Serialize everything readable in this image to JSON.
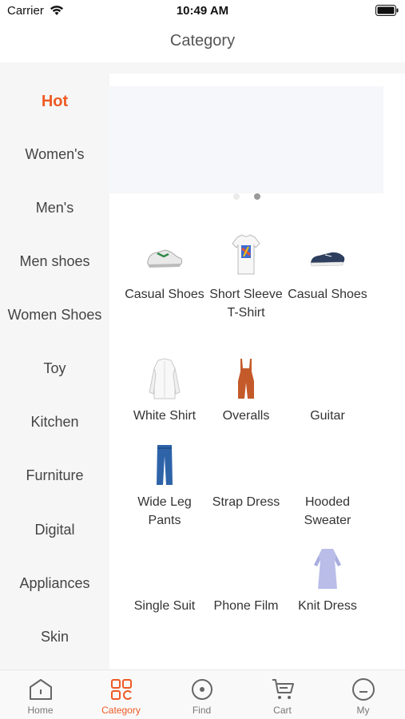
{
  "status_bar": {
    "carrier": "Carrier",
    "time": "10:49 AM"
  },
  "nav": {
    "title": "Category"
  },
  "sidebar": {
    "items": [
      {
        "label": "Hot",
        "active": true
      },
      {
        "label": "Women's"
      },
      {
        "label": "Men's"
      },
      {
        "label": "Men shoes"
      },
      {
        "label": "Women Shoes"
      },
      {
        "label": "Toy"
      },
      {
        "label": "Kitchen"
      },
      {
        "label": "Furniture"
      },
      {
        "label": "Digital"
      },
      {
        "label": "Appliances"
      },
      {
        "label": "Skin"
      }
    ]
  },
  "banner": {
    "page_count": 2,
    "active_page": 2
  },
  "products": [
    {
      "label": "Casual Shoes",
      "icon": "sneaker-image"
    },
    {
      "label": "Short Sleeve T-Shirt",
      "icon": "tshirt-image"
    },
    {
      "label": "Casual Shoes",
      "icon": "navy-shoe-image"
    },
    {
      "label": "White Shirt",
      "icon": "white-shirt-image"
    },
    {
      "label": "Overalls",
      "icon": "overalls-image"
    },
    {
      "label": "Guitar",
      "icon": ""
    },
    {
      "label": "Wide Leg Pants",
      "icon": "jeans-image"
    },
    {
      "label": "Strap Dress",
      "icon": ""
    },
    {
      "label": "Hooded Sweater",
      "icon": ""
    },
    {
      "label": "Single Suit",
      "icon": ""
    },
    {
      "label": "Phone Film",
      "icon": ""
    },
    {
      "label": "Knit Dress",
      "icon": "knit-dress-image"
    }
  ],
  "tab_bar": {
    "tabs": [
      {
        "label": "Home",
        "icon": "home-icon"
      },
      {
        "label": "Category",
        "icon": "category-icon",
        "active": true
      },
      {
        "label": "Find",
        "icon": "find-icon"
      },
      {
        "label": "Cart",
        "icon": "cart-icon"
      },
      {
        "label": "My",
        "icon": "profile-icon"
      }
    ]
  },
  "colors": {
    "accent": "#ee5a24",
    "text": "#333333",
    "muted": "#777777"
  }
}
